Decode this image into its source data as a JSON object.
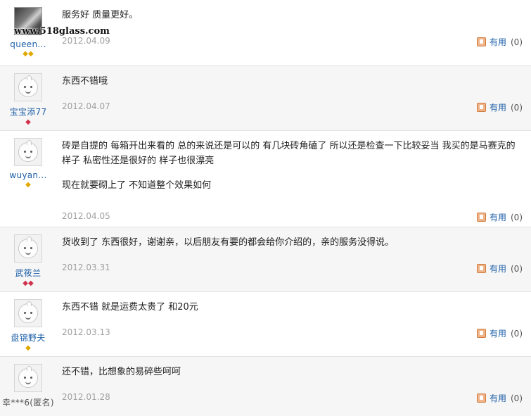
{
  "watermark": "www.518glass.com",
  "useful_label": "有用",
  "reviews": [
    {
      "username": "queen...",
      "text": "服务好 质量更好。",
      "text2": "",
      "date": "2012.04.09",
      "useful_count": "(0)",
      "badge": "gold",
      "badge_count": 2
    },
    {
      "username": "宝宝添77",
      "text": "东西不错哦",
      "text2": "",
      "date": "2012.04.07",
      "useful_count": "(0)",
      "badge": "red",
      "badge_count": 1
    },
    {
      "username": "wuyan...",
      "text": "砖是自提的 每箱开出来看的 总的来说还是可以的 有几块砖角磕了 所以还是检查一下比较妥当 我买的是马赛克的样子 私密性还是很好的 样子也很漂亮",
      "text2": "现在就要砌上了 不知道整个效果如何",
      "date": "2012.04.05",
      "useful_count": "(0)",
      "badge": "gold",
      "badge_count": 1
    },
    {
      "username": "武筱兰",
      "text": "货收到了 东西很好，谢谢亲，以后朋友有要的都会给你介绍的，亲的服务没得说。",
      "text2": "",
      "date": "2012.03.31",
      "useful_count": "(0)",
      "badge": "red",
      "badge_count": 2
    },
    {
      "username": "盘锦野夫",
      "text": "东西不错 就是运费太贵了 和20元",
      "text2": "",
      "date": "2012.03.13",
      "useful_count": "(0)",
      "badge": "gold",
      "badge_count": 1
    },
    {
      "username": "幸***6(匿名)",
      "text": "还不错，比想象的易碎些呵呵",
      "text2": "",
      "date": "2012.01.28",
      "useful_count": "(0)",
      "badge": "none",
      "badge_count": 0
    }
  ]
}
